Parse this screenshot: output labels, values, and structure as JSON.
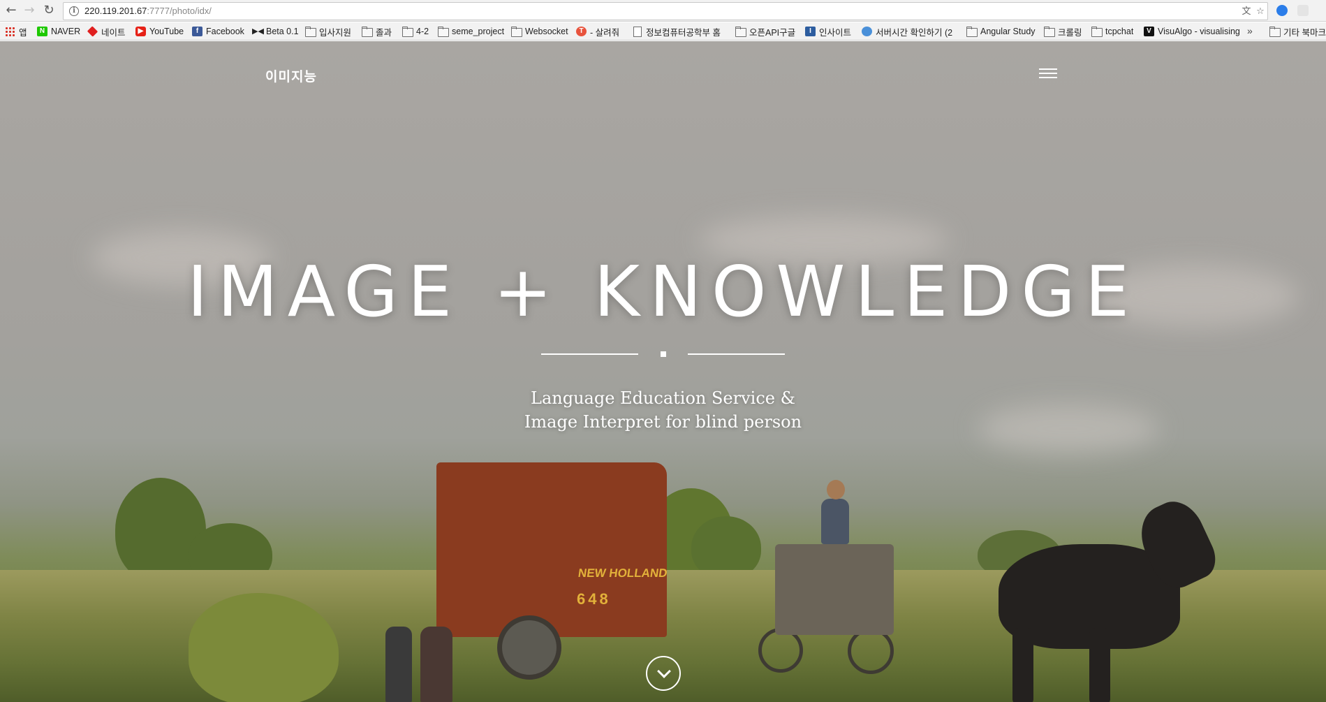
{
  "browser": {
    "url_host": "220.119.201.67",
    "url_rest": ":7777/photo/idx/",
    "bookmarks": [
      {
        "label": "앱",
        "icon": "apps-grid-icon"
      },
      {
        "label": "NAVER",
        "icon": "naver-icon"
      },
      {
        "label": "네이트",
        "icon": "nate-icon"
      },
      {
        "label": "YouTube",
        "icon": "youtube-icon"
      },
      {
        "label": "Facebook",
        "icon": "facebook-icon"
      },
      {
        "label": "Beta 0.1",
        "icon": "bowtie-icon"
      },
      {
        "label": "입사지원",
        "icon": "folder-icon"
      },
      {
        "label": "졸과",
        "icon": "folder-icon"
      },
      {
        "label": "4-2",
        "icon": "folder-icon"
      },
      {
        "label": "seme_project",
        "icon": "folder-icon"
      },
      {
        "label": "Websocket",
        "icon": "folder-icon"
      },
      {
        "label": "- 살려줘",
        "icon": "circle-t-icon"
      },
      {
        "label": "정보컴퓨터공학부 홈",
        "icon": "page-icon"
      },
      {
        "label": "오픈API구글",
        "icon": "folder-icon"
      },
      {
        "label": "인사이트",
        "icon": "i-icon"
      },
      {
        "label": "서버시간 확인하기 (2",
        "icon": "clock-icon"
      },
      {
        "label": "Angular Study",
        "icon": "folder-icon"
      },
      {
        "label": "크롤링",
        "icon": "folder-icon"
      },
      {
        "label": "tcpchat",
        "icon": "folder-icon"
      },
      {
        "label": "VisuAlgo - visualising",
        "icon": "visualgo-icon"
      }
    ],
    "more_bookmarks": "»",
    "other_bookmarks": "기타 북마크"
  },
  "site": {
    "brand": "이미지능",
    "hero_title": "IMAGE + KNOWLEDGE",
    "subtitle_line1": "Language Education Service &",
    "subtitle_line2": "Image Interpret for blind person"
  },
  "colors": {
    "accent_text": "#ffffff",
    "baler": "#8a3b1f"
  }
}
